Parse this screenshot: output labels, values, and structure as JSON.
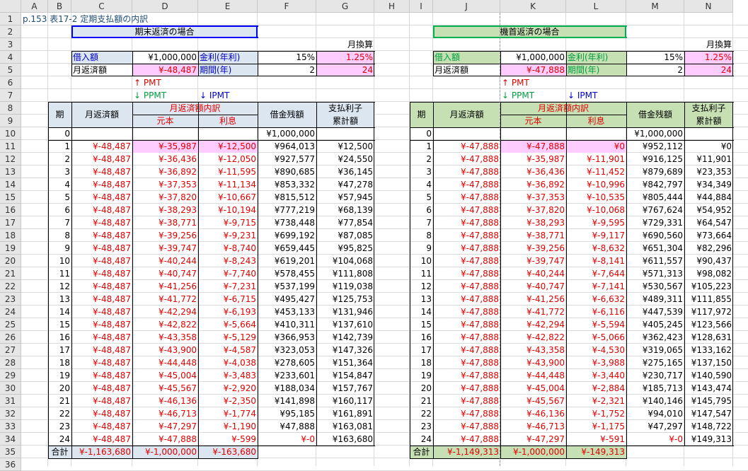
{
  "columns": [
    "A",
    "B",
    "C",
    "D",
    "E",
    "F",
    "G",
    "H",
    "I",
    "J",
    "K",
    "L",
    "M",
    "N"
  ],
  "rows": [
    "1",
    "2",
    "3",
    "4",
    "5",
    "6",
    "7",
    "8",
    "9",
    "10",
    "11",
    "12",
    "13",
    "14",
    "15",
    "16",
    "17",
    "18",
    "19",
    "20",
    "21",
    "22",
    "23",
    "24",
    "25",
    "26",
    "27",
    "28",
    "29",
    "30",
    "31",
    "32",
    "33",
    "34",
    "35",
    "36"
  ],
  "title": "p.153  表17-2  定期支払額の内訳",
  "colors": {
    "header_blue": "#dce6f1",
    "header_green": "#c6e0b4",
    "pink": "#ffccff",
    "red": "#e00000",
    "box_blue": "#0000ff",
    "box_green": "#00b050"
  },
  "left": {
    "box_title": "期末返済の場合",
    "month_label": "月換算",
    "loan_label": "借入額",
    "loan_value": "¥1,000,000",
    "rate_label": "金利(年利)",
    "rate_value": "15%",
    "monthly_rate": "1.25%",
    "payment_label": "月返済額",
    "payment_value": "¥-48,487",
    "term_label": "期間(年)",
    "term_value": "2",
    "term_months": "24",
    "note_pmt": "↑ PMT",
    "note_ppmt": "↓ PPMT",
    "note_ipmt": "↓ IPMT",
    "h_period": "期",
    "h_payment": "月返済額",
    "h_breakdown": "月返済額内訳",
    "h_principal": "元本",
    "h_interest": "利息",
    "h_balance": "借金残額",
    "h_cum1": "支払利子",
    "h_cum2": "累計額",
    "row10": {
      "period": "0",
      "balance": "¥1,000,000"
    },
    "rows": [
      [
        "1",
        "¥-48,487",
        "¥-35,987",
        "¥-12,500",
        "¥964,013",
        "¥12,500"
      ],
      [
        "2",
        "¥-48,487",
        "¥-36,436",
        "¥-12,050",
        "¥927,577",
        "¥24,550"
      ],
      [
        "3",
        "¥-48,487",
        "¥-36,892",
        "¥-11,595",
        "¥890,685",
        "¥36,145"
      ],
      [
        "4",
        "¥-48,487",
        "¥-37,353",
        "¥-11,134",
        "¥853,332",
        "¥47,278"
      ],
      [
        "5",
        "¥-48,487",
        "¥-37,820",
        "¥-10,667",
        "¥815,512",
        "¥57,945"
      ],
      [
        "6",
        "¥-48,487",
        "¥-38,293",
        "¥-10,194",
        "¥777,219",
        "¥68,139"
      ],
      [
        "7",
        "¥-48,487",
        "¥-38,771",
        "¥-9,715",
        "¥738,448",
        "¥77,854"
      ],
      [
        "8",
        "¥-48,487",
        "¥-39,256",
        "¥-9,231",
        "¥699,192",
        "¥87,085"
      ],
      [
        "9",
        "¥-48,487",
        "¥-39,747",
        "¥-8,740",
        "¥659,445",
        "¥95,825"
      ],
      [
        "10",
        "¥-48,487",
        "¥-40,244",
        "¥-8,243",
        "¥619,201",
        "¥104,068"
      ],
      [
        "11",
        "¥-48,487",
        "¥-40,747",
        "¥-7,740",
        "¥578,455",
        "¥111,808"
      ],
      [
        "12",
        "¥-48,487",
        "¥-41,256",
        "¥-7,231",
        "¥537,199",
        "¥119,038"
      ],
      [
        "13",
        "¥-48,487",
        "¥-41,772",
        "¥-6,715",
        "¥495,427",
        "¥125,753"
      ],
      [
        "14",
        "¥-48,487",
        "¥-42,294",
        "¥-6,193",
        "¥453,133",
        "¥131,946"
      ],
      [
        "15",
        "¥-48,487",
        "¥-42,822",
        "¥-5,664",
        "¥410,311",
        "¥137,610"
      ],
      [
        "16",
        "¥-48,487",
        "¥-43,358",
        "¥-5,129",
        "¥366,953",
        "¥142,739"
      ],
      [
        "17",
        "¥-48,487",
        "¥-43,900",
        "¥-4,587",
        "¥323,053",
        "¥147,326"
      ],
      [
        "18",
        "¥-48,487",
        "¥-44,448",
        "¥-4,038",
        "¥278,605",
        "¥151,364"
      ],
      [
        "19",
        "¥-48,487",
        "¥-45,004",
        "¥-3,483",
        "¥233,601",
        "¥154,847"
      ],
      [
        "20",
        "¥-48,487",
        "¥-45,567",
        "¥-2,920",
        "¥188,034",
        "¥157,767"
      ],
      [
        "21",
        "¥-48,487",
        "¥-46,136",
        "¥-2,350",
        "¥141,898",
        "¥160,117"
      ],
      [
        "22",
        "¥-48,487",
        "¥-46,713",
        "¥-1,774",
        "¥95,185",
        "¥161,891"
      ],
      [
        "23",
        "¥-48,487",
        "¥-47,297",
        "¥-1,190",
        "¥47,888",
        "¥163,081"
      ],
      [
        "24",
        "¥-48,487",
        "¥-47,888",
        "¥-599",
        "¥-0",
        "¥163,680"
      ]
    ],
    "total": {
      "label": "合計",
      "payment": "¥-1,163,680",
      "principal": "¥-1,000,000",
      "interest": "¥-163,680"
    }
  },
  "right": {
    "box_title": "機首返済の場合",
    "month_label": "月換算",
    "loan_label": "借入額",
    "loan_value": "¥1,000,000",
    "rate_label": "金利(年利)",
    "rate_value": "15%",
    "monthly_rate": "1.25%",
    "payment_label": "月返済額",
    "payment_value": "¥-47,888",
    "term_label": "期間(年)",
    "term_value": "2",
    "term_months": "24",
    "note_pmt": "↑ PMT",
    "note_ppmt": "↓ PPMT",
    "note_ipmt": "↓ IPMT",
    "h_period": "期",
    "h_payment": "月返済額",
    "h_breakdown": "月返済額内訳",
    "h_principal": "元本",
    "h_interest": "利息",
    "h_balance": "借金残額",
    "h_cum1": "支払利子",
    "h_cum2": "累計額",
    "row10": {
      "period": "0",
      "balance": "¥1,000,000"
    },
    "rows": [
      [
        "1",
        "¥-47,888",
        "¥-47,888",
        "¥0",
        "¥952,112",
        "¥0"
      ],
      [
        "2",
        "¥-47,888",
        "¥-35,987",
        "¥-11,901",
        "¥916,125",
        "¥11,901"
      ],
      [
        "3",
        "¥-47,888",
        "¥-36,436",
        "¥-11,452",
        "¥879,689",
        "¥23,353"
      ],
      [
        "4",
        "¥-47,888",
        "¥-36,892",
        "¥-10,996",
        "¥842,797",
        "¥34,349"
      ],
      [
        "5",
        "¥-47,888",
        "¥-37,353",
        "¥-10,535",
        "¥805,444",
        "¥44,884"
      ],
      [
        "6",
        "¥-47,888",
        "¥-37,820",
        "¥-10,068",
        "¥767,624",
        "¥54,952"
      ],
      [
        "7",
        "¥-47,888",
        "¥-38,293",
        "¥-9,595",
        "¥729,331",
        "¥64,547"
      ],
      [
        "8",
        "¥-47,888",
        "¥-38,771",
        "¥-9,117",
        "¥690,560",
        "¥73,664"
      ],
      [
        "9",
        "¥-47,888",
        "¥-39,256",
        "¥-8,632",
        "¥651,304",
        "¥82,296"
      ],
      [
        "10",
        "¥-47,888",
        "¥-39,747",
        "¥-8,141",
        "¥611,557",
        "¥90,437"
      ],
      [
        "11",
        "¥-47,888",
        "¥-40,244",
        "¥-7,644",
        "¥571,313",
        "¥98,082"
      ],
      [
        "12",
        "¥-47,888",
        "¥-40,747",
        "¥-7,141",
        "¥530,567",
        "¥105,223"
      ],
      [
        "13",
        "¥-47,888",
        "¥-41,256",
        "¥-6,632",
        "¥489,311",
        "¥111,855"
      ],
      [
        "14",
        "¥-47,888",
        "¥-41,772",
        "¥-6,116",
        "¥447,539",
        "¥117,972"
      ],
      [
        "15",
        "¥-47,888",
        "¥-42,294",
        "¥-5,594",
        "¥405,245",
        "¥123,566"
      ],
      [
        "16",
        "¥-47,888",
        "¥-42,822",
        "¥-5,066",
        "¥362,423",
        "¥128,631"
      ],
      [
        "17",
        "¥-47,888",
        "¥-43,358",
        "¥-4,530",
        "¥319,065",
        "¥133,162"
      ],
      [
        "18",
        "¥-47,888",
        "¥-43,900",
        "¥-3,988",
        "¥275,165",
        "¥137,150"
      ],
      [
        "19",
        "¥-47,888",
        "¥-44,448",
        "¥-3,440",
        "¥230,717",
        "¥140,590"
      ],
      [
        "20",
        "¥-47,888",
        "¥-45,004",
        "¥-2,884",
        "¥185,713",
        "¥143,474"
      ],
      [
        "21",
        "¥-47,888",
        "¥-45,567",
        "¥-2,321",
        "¥140,146",
        "¥145,795"
      ],
      [
        "22",
        "¥-47,888",
        "¥-46,136",
        "¥-1,752",
        "¥94,010",
        "¥147,547"
      ],
      [
        "23",
        "¥-47,888",
        "¥-46,713",
        "¥-1,175",
        "¥47,297",
        "¥148,722"
      ],
      [
        "24",
        "¥-47,888",
        "¥-47,297",
        "¥-591",
        "¥-0",
        "¥149,313"
      ]
    ],
    "total": {
      "label": "合計",
      "payment": "¥-1,149,313",
      "principal": "¥-1,000,000",
      "interest": "¥-149,313"
    }
  }
}
